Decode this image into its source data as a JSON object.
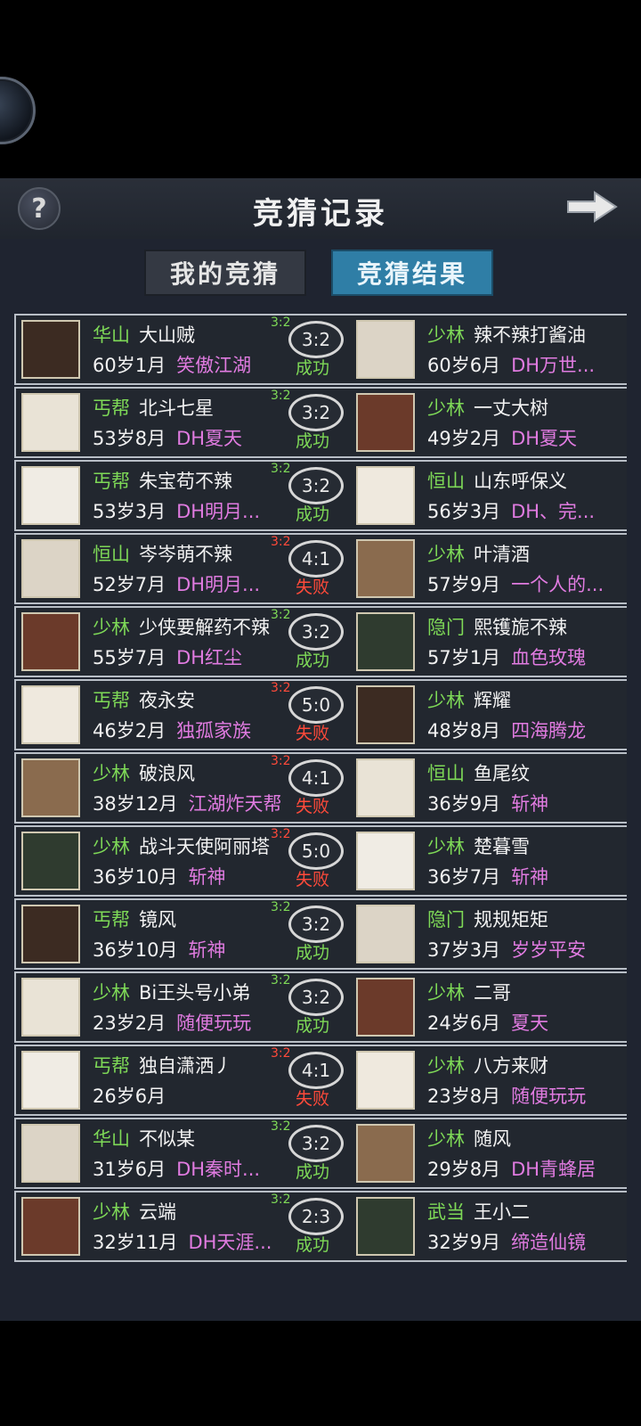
{
  "header": {
    "title": "竞猜记录",
    "help_icon": "?"
  },
  "tabs": [
    {
      "label": "我的竞猜",
      "active": false
    },
    {
      "label": "竞猜结果",
      "active": true
    }
  ],
  "colors": {
    "sect": "#7ed957",
    "guild": "#e07be0",
    "success": "#7ed957",
    "fail": "#ff4a3a",
    "tab_active": "#2f7ea6"
  },
  "rows": [
    {
      "tag": "3:2",
      "tag_color": "green",
      "score": "3:2",
      "result": "成功",
      "result_type": "ok",
      "left": {
        "sect": "华山",
        "name": "大山贼",
        "age": "60岁1月",
        "guild": "笑傲江湖"
      },
      "right": {
        "sect": "少林",
        "name": "辣不辣打酱油",
        "age": "60岁6月",
        "guild": "DH万世..."
      }
    },
    {
      "tag": "3:2",
      "tag_color": "green",
      "score": "3:2",
      "result": "成功",
      "result_type": "ok",
      "left": {
        "sect": "丐帮",
        "name": "北斗七星",
        "age": "53岁8月",
        "guild": "DH夏天"
      },
      "right": {
        "sect": "少林",
        "name": "一丈大树",
        "age": "49岁2月",
        "guild": "DH夏天"
      }
    },
    {
      "tag": "3:2",
      "tag_color": "green",
      "score": "3:2",
      "result": "成功",
      "result_type": "ok",
      "left": {
        "sect": "丐帮",
        "name": "朱宝苟不辣",
        "age": "53岁3月",
        "guild": "DH明月..."
      },
      "right": {
        "sect": "恒山",
        "name": "山东呼保义",
        "age": "56岁3月",
        "guild": "DH、完..."
      }
    },
    {
      "tag": "3:2",
      "tag_color": "red",
      "score": "4:1",
      "result": "失败",
      "result_type": "fail",
      "left": {
        "sect": "恒山",
        "name": "岑岑萌不辣",
        "age": "52岁7月",
        "guild": "DH明月..."
      },
      "right": {
        "sect": "少林",
        "name": "叶清酒",
        "age": "57岁9月",
        "guild": "一个人的..."
      }
    },
    {
      "tag": "3:2",
      "tag_color": "green",
      "score": "3:2",
      "result": "成功",
      "result_type": "ok",
      "left": {
        "sect": "少林",
        "name": "少侠要解药不辣",
        "age": "55岁7月",
        "guild": "DH红尘"
      },
      "right": {
        "sect": "隐门",
        "name": "熙镬旎不辣",
        "age": "57岁1月",
        "guild": "血色玫瑰"
      }
    },
    {
      "tag": "3:2",
      "tag_color": "red",
      "score": "5:0",
      "result": "失败",
      "result_type": "fail",
      "left": {
        "sect": "丐帮",
        "name": "夜永安",
        "age": "46岁2月",
        "guild": "独孤家族"
      },
      "right": {
        "sect": "少林",
        "name": "辉耀",
        "age": "48岁8月",
        "guild": "四海腾龙"
      }
    },
    {
      "tag": "3:2",
      "tag_color": "red",
      "score": "4:1",
      "result": "失败",
      "result_type": "fail",
      "left": {
        "sect": "少林",
        "name": "破浪风",
        "age": "38岁12月",
        "guild": "江湖炸天帮"
      },
      "right": {
        "sect": "恒山",
        "name": "鱼尾纹",
        "age": "36岁9月",
        "guild": "斩神"
      }
    },
    {
      "tag": "3:2",
      "tag_color": "red",
      "score": "5:0",
      "result": "失败",
      "result_type": "fail",
      "left": {
        "sect": "少林",
        "name": "战斗天使阿丽塔",
        "age": "36岁10月",
        "guild": "斩神"
      },
      "right": {
        "sect": "少林",
        "name": "楚暮雪",
        "age": "36岁7月",
        "guild": "斩神"
      }
    },
    {
      "tag": "3:2",
      "tag_color": "green",
      "score": "3:2",
      "result": "成功",
      "result_type": "ok",
      "left": {
        "sect": "丐帮",
        "name": "镜风",
        "age": "36岁10月",
        "guild": "斩神"
      },
      "right": {
        "sect": "隐门",
        "name": "规规矩矩",
        "age": "37岁3月",
        "guild": "岁岁平安"
      }
    },
    {
      "tag": "3:2",
      "tag_color": "green",
      "score": "3:2",
      "result": "成功",
      "result_type": "ok",
      "left": {
        "sect": "少林",
        "name": "Bi王头号小弟",
        "age": "23岁2月",
        "guild": "随便玩玩"
      },
      "right": {
        "sect": "少林",
        "name": "二哥",
        "age": "24岁6月",
        "guild": "夏天"
      }
    },
    {
      "tag": "3:2",
      "tag_color": "red",
      "score": "4:1",
      "result": "失败",
      "result_type": "fail",
      "left": {
        "sect": "丐帮",
        "name": "独自潇洒丿",
        "age": "26岁6月",
        "guild": ""
      },
      "right": {
        "sect": "少林",
        "name": "八方来财",
        "age": "23岁8月",
        "guild": "随便玩玩"
      }
    },
    {
      "tag": "3:2",
      "tag_color": "green",
      "score": "3:2",
      "result": "成功",
      "result_type": "ok",
      "left": {
        "sect": "华山",
        "name": "不似某",
        "age": "31岁6月",
        "guild": "DH秦时..."
      },
      "right": {
        "sect": "少林",
        "name": "随风",
        "age": "29岁8月",
        "guild": "DH青蜂居"
      }
    },
    {
      "tag": "3:2",
      "tag_color": "green",
      "score": "2:3",
      "result": "成功",
      "result_type": "ok",
      "left": {
        "sect": "少林",
        "name": "云端",
        "age": "32岁11月",
        "guild": "DH天涯..."
      },
      "right": {
        "sect": "武当",
        "name": "王小二",
        "age": "32岁9月",
        "guild": "缔造仙镜"
      }
    }
  ]
}
